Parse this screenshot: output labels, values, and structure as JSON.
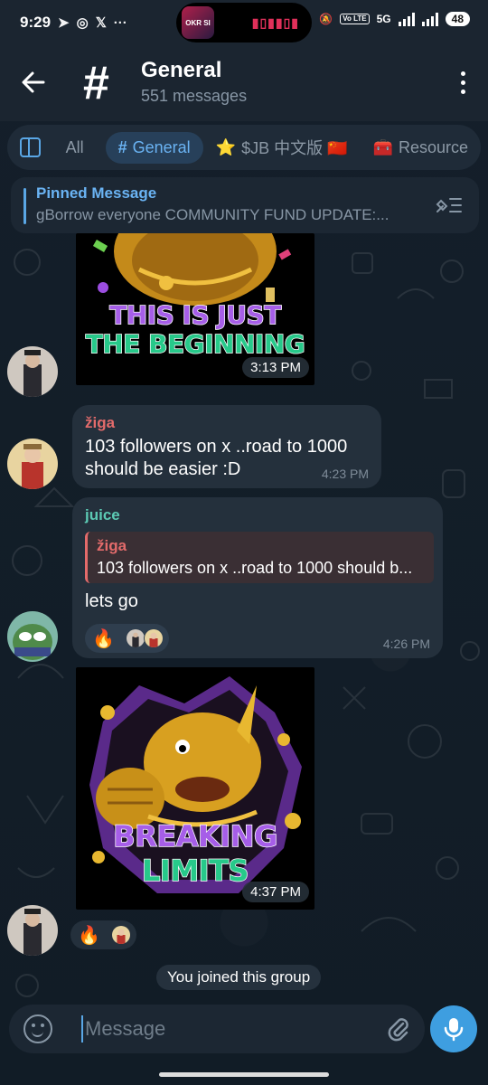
{
  "status_bar": {
    "time": "9:29",
    "app_icons": [
      "telegram-icon",
      "whatsapp-icon",
      "x-icon",
      "more-icon"
    ],
    "island_thumb": "OKR SI",
    "network": "5G",
    "volte": "Vo LTE",
    "battery": "48"
  },
  "header": {
    "icon": "#",
    "title": "General",
    "subtitle": "551 messages"
  },
  "tabs": [
    {
      "label": "All",
      "icon": "",
      "active": false
    },
    {
      "label": "General",
      "icon": "#",
      "active": true
    },
    {
      "label": "$JB 中文版 🇨🇳",
      "icon": "⭐",
      "active": false
    },
    {
      "label": "Resource",
      "icon": "🧰",
      "active": false
    }
  ],
  "pinned": {
    "title": "Pinned Message",
    "text": "gBorrow everyone   COMMUNITY FUND UPDATE:..."
  },
  "messages": [
    {
      "type": "sticker",
      "caption": "THIS IS JUST THE BEGINNING",
      "line1": "THIS IS JUST",
      "line2": "THE BEGINNING",
      "time": "3:13 PM"
    },
    {
      "type": "text",
      "sender": "žiga",
      "sender_color": "#e36b6b",
      "text": "103 followers on x ..road to 1000 should be easier :D",
      "line1": "103 followers on x ..road to 1000",
      "line2": "should be easier :D",
      "time": "4:23 PM"
    },
    {
      "type": "reply",
      "sender": "juice",
      "sender_color": "#5ccab4",
      "reply_sender": "žiga",
      "reply_text": "103 followers on x ..road to 1000 should b...",
      "text": "lets go",
      "reaction": "🔥",
      "time": "4:26 PM"
    },
    {
      "type": "sticker",
      "caption": "BREAKING LIMITS",
      "line1": "BREAKING",
      "line2": "LIMITS",
      "time": "4:37 PM",
      "reaction": "🔥"
    }
  ],
  "service_message": "You joined this group",
  "input": {
    "placeholder": "Message"
  },
  "colors": {
    "accent": "#5aa7e6",
    "background": "#0f1a24",
    "bubble": "#24303c",
    "mic": "#3e9ee0"
  }
}
